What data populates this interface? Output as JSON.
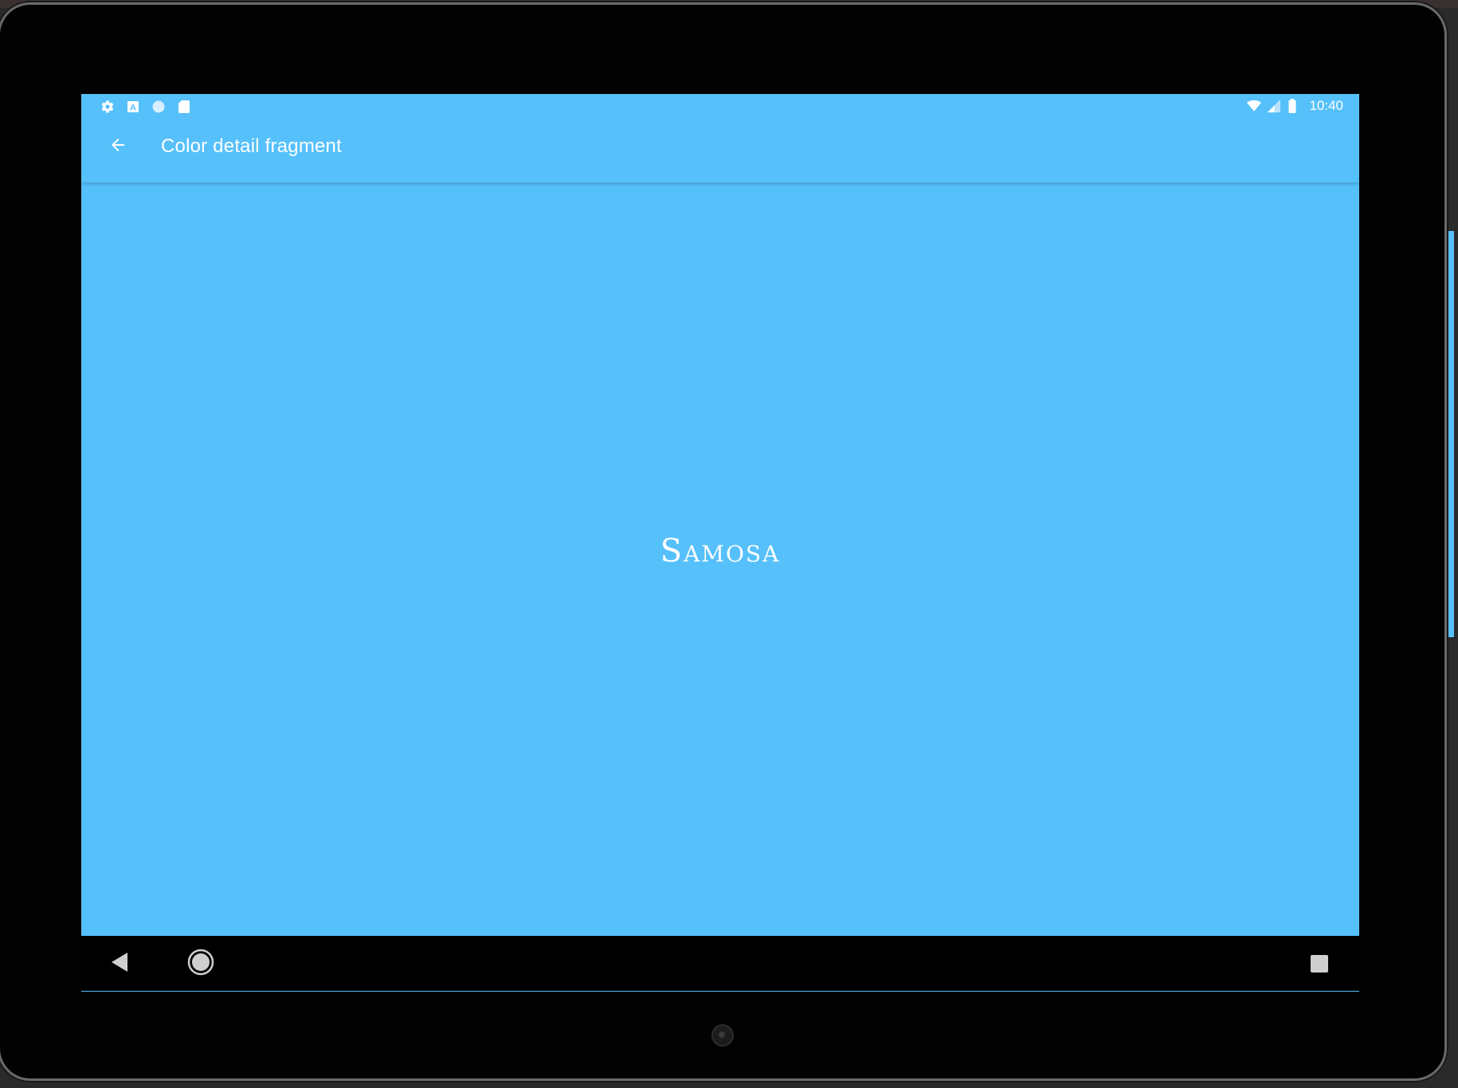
{
  "status_bar": {
    "left_icons": [
      "settings-icon",
      "a-notification-icon",
      "circle-notification-icon",
      "sd-card-icon"
    ],
    "right_icons": [
      "wifi-icon",
      "cell-signal-icon",
      "battery-icon"
    ],
    "time": "10:40"
  },
  "app_bar": {
    "back_icon": "arrow-back-icon",
    "title": "Color detail fragment"
  },
  "content": {
    "color_name": "Samosa",
    "background_color": "#56c0fb"
  },
  "nav_bar": {
    "buttons": [
      "back-triangle-icon",
      "home-circle-icon",
      "recents-square-icon"
    ]
  },
  "colors": {
    "accent": "#56c0fb",
    "text": "#ffffff",
    "bezel": "#020202"
  }
}
